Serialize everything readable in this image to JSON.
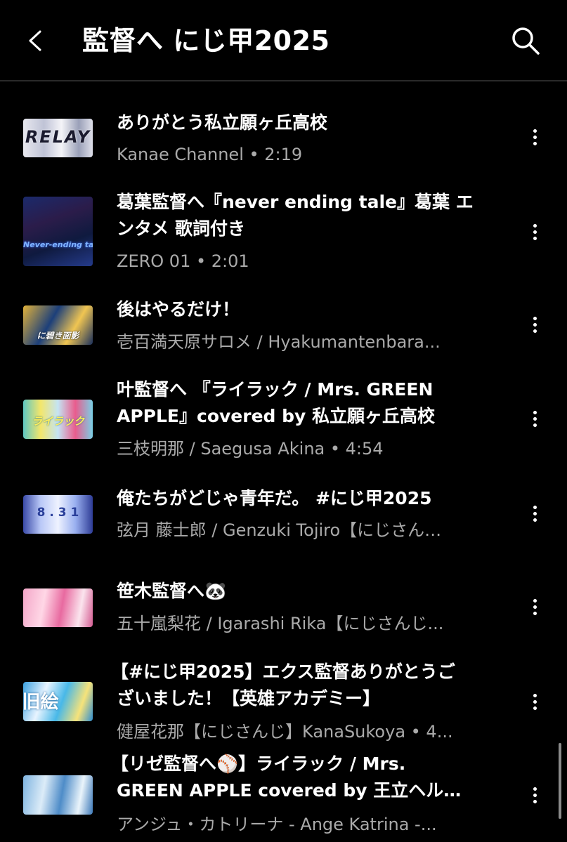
{
  "header": {
    "title": "監督へ にじ甲2025",
    "back_icon": "chevron-left-icon",
    "search_icon": "search-icon"
  },
  "videos": [
    {
      "title_line1": "ありがとう私立願ヶ丘高校",
      "title_line2": "",
      "meta": "Kanae Channel • 2:19",
      "thumb_text": "RELAY"
    },
    {
      "title_line1": "葛葉監督へ『never ending tale』葛葉 エ",
      "title_line2": "ンタメ 歌詞付き",
      "meta": "ZERO 01 • 2:01",
      "thumb_text": "Never-ending tale"
    },
    {
      "title_line1": "後はやるだけ！",
      "title_line2": "",
      "meta": "壱百満天原サロメ / Hyakumantenbara...",
      "thumb_text": "に碧き面影"
    },
    {
      "title_line1": "叶監督へ 『ライラック / Mrs. GREEN",
      "title_line2": "APPLE』covered by 私立願ヶ丘高校",
      "meta": "三枝明那 / Saegusa Akina • 4:54",
      "thumb_text": "ライラック"
    },
    {
      "title_line1": "俺たちがどじゃ青年だ。 #にじ甲2025",
      "title_line2": "",
      "meta": "弦月 藤士郎 / Genzuki Tojiro【にじさん…",
      "thumb_text": "8 . 3 1"
    },
    {
      "title_line1": "笹木監督へ🐼",
      "title_line2": "",
      "meta": "五十嵐梨花 / Igarashi Rika【にじさんじ...",
      "thumb_text": ""
    },
    {
      "title_line1": "【#にじ甲2025】エクス監督ありがとうご",
      "title_line2": "ざいました！【英雄アカデミー】",
      "meta": "健屋花那【にじさんじ】KanaSukoya • 4...",
      "thumb_text": "旧絵"
    },
    {
      "title_line1": "【リゼ監督へ⚾】ライラック / Mrs.",
      "title_line2": "GREEN APPLE covered by 王立ヘル…",
      "meta": "アンジュ・カトリーナ - Ange Katrina -...",
      "thumb_text": ""
    }
  ],
  "more_icon": "more-vertical-icon"
}
